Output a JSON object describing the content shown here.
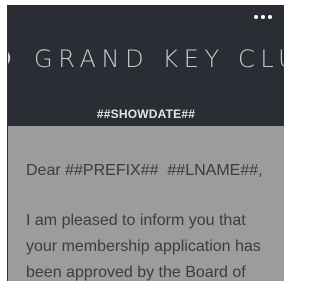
{
  "header": {
    "brand_name": "GRAND KEY CLUB",
    "show_date": "##SHOWDATE##",
    "more_menu": {
      "icon": "more-horizontal-icon",
      "glyph": "•••"
    }
  },
  "body": {
    "greeting": "Dear ##PREFIX##  ##LNAME##,",
    "paragraph_lines": [
      "I am pleased to inform you that",
      "your membership application has",
      "been approved by the Board of"
    ]
  },
  "colors": {
    "header_background": "#2a2d34",
    "body_background": "#9c9c9c",
    "body_text": "#3c3c3c",
    "brand_text": "#c9ccd1"
  }
}
